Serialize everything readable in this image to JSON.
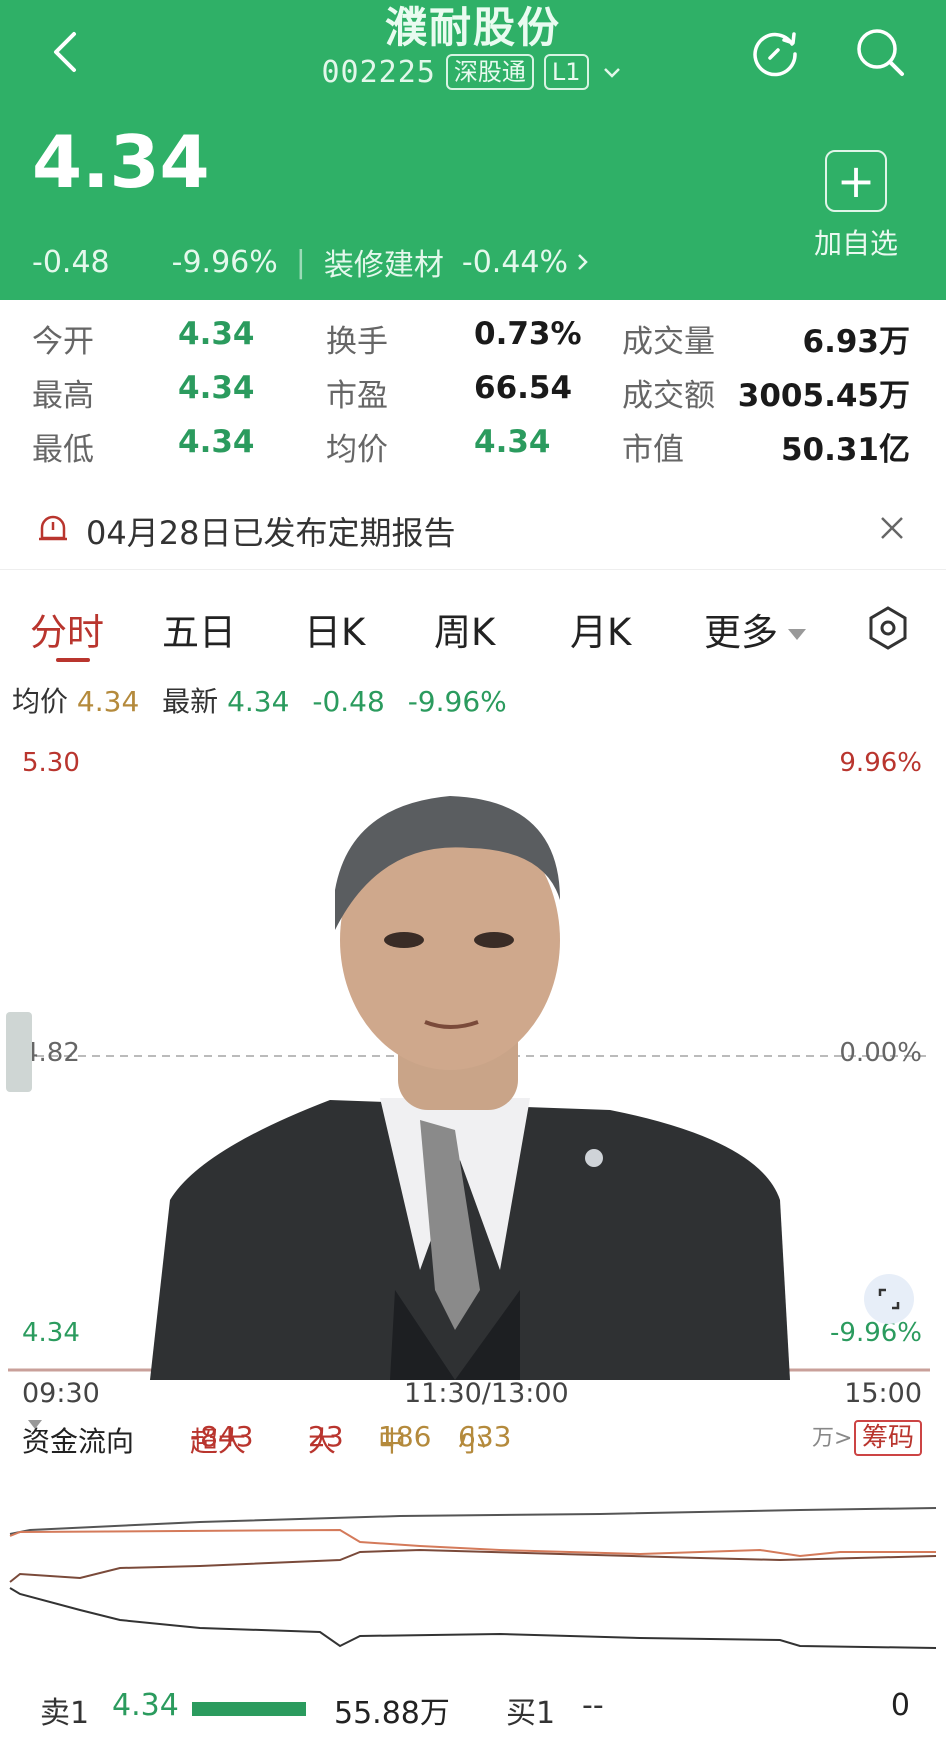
{
  "header": {
    "title": "濮耐股份",
    "code": "002225",
    "tag1": "深股通",
    "tag2": "L1",
    "price": "4.34",
    "change": "-0.48",
    "change_pct": "-9.96%",
    "sector": "装修建材",
    "sector_change": "-0.44%",
    "add_label": "加自选",
    "bg_color": "#2fb067"
  },
  "stats": {
    "open_label": "今开",
    "open": "4.34",
    "turnover_label": "换手",
    "turnover": "0.73%",
    "volume_label": "成交量",
    "volume": "6.93万",
    "high_label": "最高",
    "high": "4.34",
    "pe_label": "市盈",
    "pe": "66.54",
    "amount_label": "成交额",
    "amount": "3005.45万",
    "low_label": "最低",
    "low": "4.34",
    "avg_label": "均价",
    "avg": "4.34",
    "mcap_label": "市值",
    "mcap": "50.31亿"
  },
  "notice": {
    "text": "04月28日已发布定期报告"
  },
  "tabs": [
    "分时",
    "五日",
    "日K",
    "周K",
    "月K",
    "更多"
  ],
  "legend": {
    "avg_label": "均价",
    "avg": "4.34",
    "latest_label": "最新",
    "latest": "4.34",
    "change": "-0.48",
    "change_pct": "-9.96%"
  },
  "chart_axis": {
    "top_price": "5.30",
    "top_pct": "9.96%",
    "mid_price": "4.82",
    "mid_pct": "0.00%",
    "bottom_price": "4.34",
    "bottom_pct": "-9.96%",
    "time_start": "09:30",
    "time_mid": "11:30/13:00",
    "time_end": "15:00"
  },
  "flow": {
    "label": "资金流向",
    "super_label": "超大",
    "super": "-843",
    "large_label": "大",
    "large": "23",
    "mid_label": "中",
    "mid": "186",
    "small_label": "小",
    "small": "633",
    "unit": "万>",
    "chouma": "筹码"
  },
  "orderbook": {
    "sell_label": "卖1",
    "sell_price": "4.34",
    "sell_vol": "55.88万",
    "buy_label": "买1",
    "buy_price": "--",
    "buy_vol": "0"
  }
}
